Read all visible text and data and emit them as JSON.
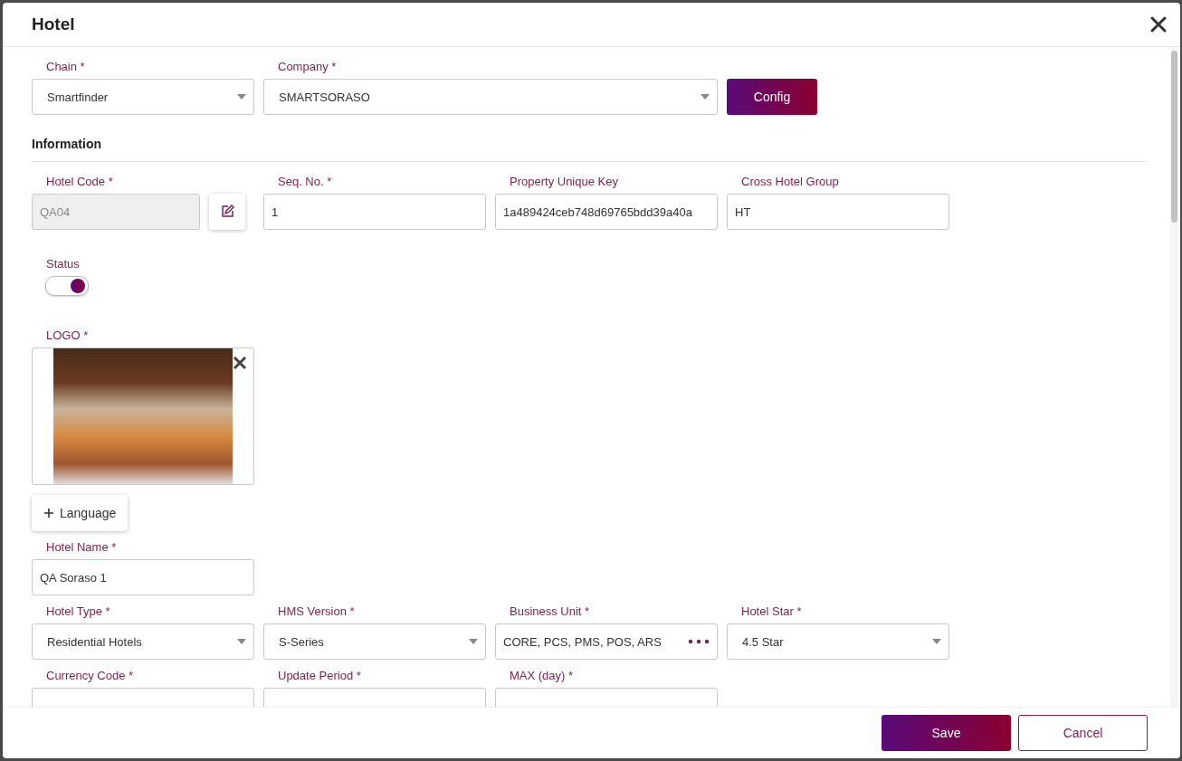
{
  "dialog": {
    "title": "Hotel"
  },
  "chain": {
    "label": "Chain *",
    "value": "Smartfinder"
  },
  "company": {
    "label": "Company *",
    "value": "SMARTSORASO"
  },
  "config_button": "Config",
  "section_title": "Information",
  "hotel_code": {
    "label": "Hotel Code *",
    "value": "QA04",
    "disabled": true
  },
  "info_fields": [
    {
      "label": "Seq. No. *",
      "value": "1"
    },
    {
      "label": "Property Unique Key",
      "value": "1a489424ceb748d69765bdd39a40a"
    },
    {
      "label": "Cross Hotel Group",
      "value": "HT"
    }
  ],
  "status": {
    "label": "Status",
    "on": true
  },
  "logo": {
    "label": "LOGO *"
  },
  "language_button": "Language",
  "hotel_name": {
    "label": "Hotel Name *",
    "value": "QA Soraso 1"
  },
  "detail_fields": [
    {
      "label": "Hotel Type *",
      "value": "Residential Hotels",
      "kind": "select"
    },
    {
      "label": "HMS Version *",
      "value": "S-Series",
      "kind": "select"
    },
    {
      "label": "Business Unit *",
      "value": "CORE, PCS, PMS, POS, ARS",
      "kind": "multi"
    },
    {
      "label": "Hotel Star *",
      "value": "4.5 Star",
      "kind": "select"
    }
  ],
  "bottom_fields": [
    {
      "label": "Currency Code *"
    },
    {
      "label": "Update Period *"
    },
    {
      "label": "MAX (day) *"
    }
  ],
  "buttons": {
    "save": "Save",
    "cancel": "Cancel"
  }
}
